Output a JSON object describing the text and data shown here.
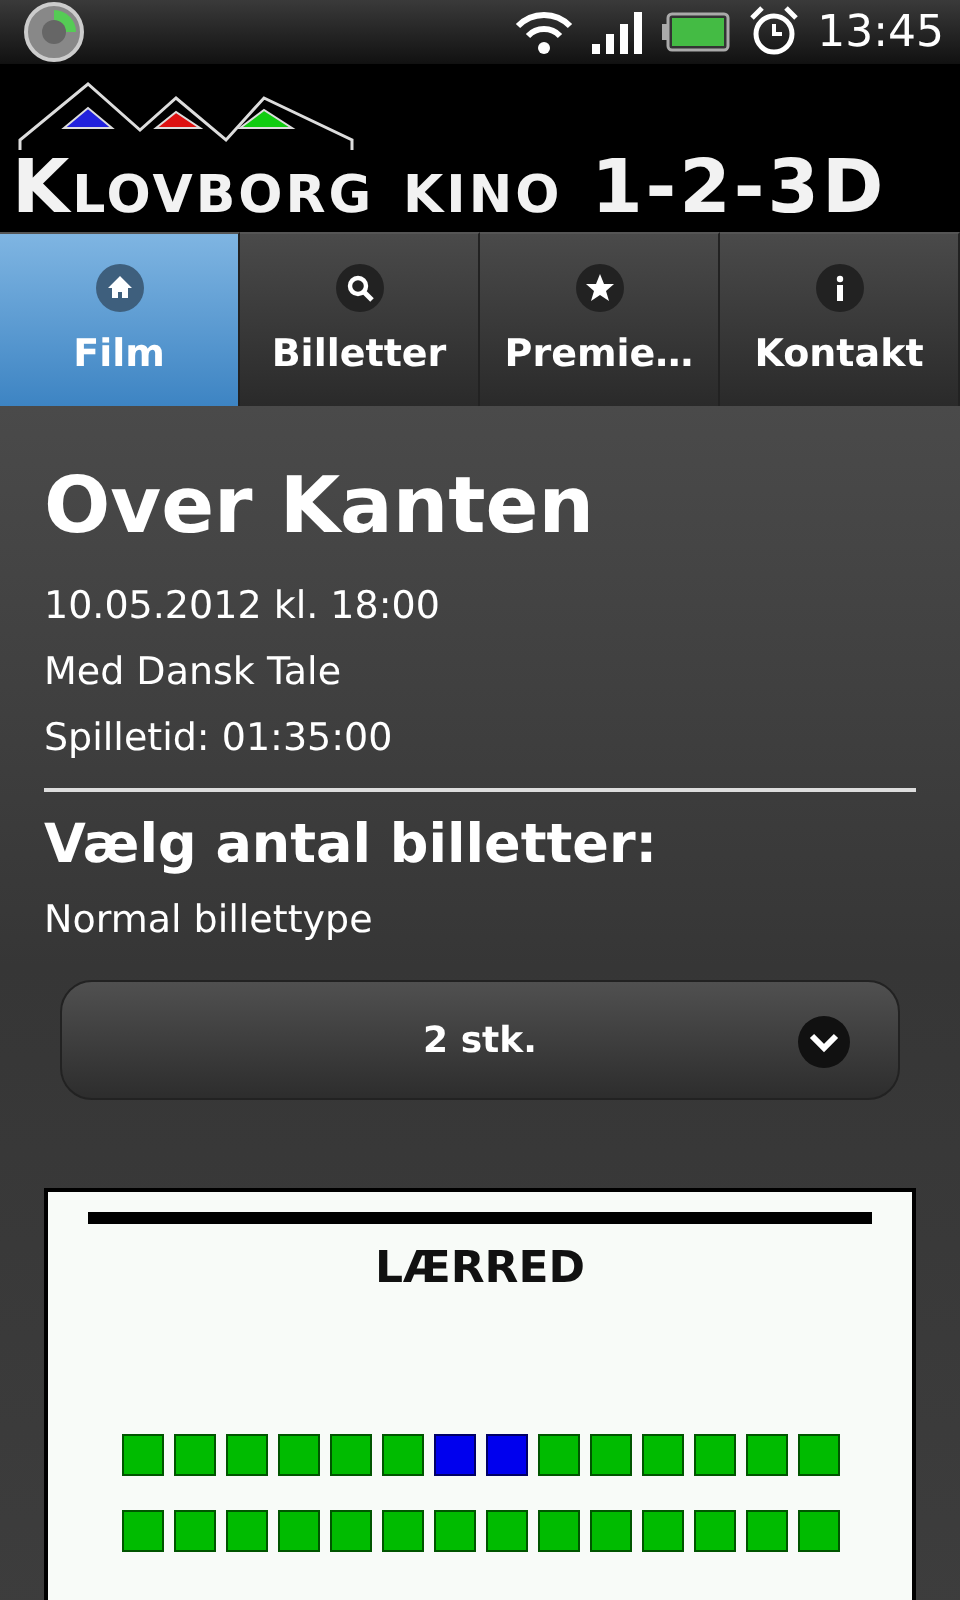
{
  "status_bar": {
    "time": "13:45"
  },
  "header": {
    "logo_text": "Klovborg kino 1-2-3D"
  },
  "tabs": [
    {
      "label": "Film",
      "kind": "home",
      "selected": true
    },
    {
      "label": "Billetter",
      "kind": "search",
      "selected": false
    },
    {
      "label": "Premie…",
      "kind": "star",
      "selected": false
    },
    {
      "label": "Kontakt",
      "kind": "info",
      "selected": false
    }
  ],
  "movie": {
    "title": "Over Kanten",
    "details": [
      "10.05.2012 kl. 18:00",
      "Med Dansk Tale",
      "Spilletid: 01:35:00"
    ]
  },
  "tickets": {
    "heading": "Vælg antal billetter:",
    "type_label": "Normal billettype",
    "quantity": "2 stk."
  },
  "seat_map": {
    "screen_label": "LÆRRED",
    "rows": [
      {
        "seats": [
          {
            "selected": false
          },
          {
            "selected": false
          },
          {
            "selected": false
          },
          {
            "selected": false
          },
          {
            "selected": false
          },
          {
            "selected": false
          },
          {
            "selected": true
          },
          {
            "selected": true
          },
          {
            "selected": false
          },
          {
            "selected": false
          },
          {
            "selected": false
          },
          {
            "selected": false
          },
          {
            "selected": false
          },
          {
            "selected": false
          }
        ]
      },
      {
        "seats": [
          {
            "selected": false
          },
          {
            "selected": false
          },
          {
            "selected": false
          },
          {
            "selected": false
          },
          {
            "selected": false
          },
          {
            "selected": false
          },
          {
            "selected": false
          },
          {
            "selected": false
          },
          {
            "selected": false
          },
          {
            "selected": false
          },
          {
            "selected": false
          },
          {
            "selected": false
          },
          {
            "selected": false
          },
          {
            "selected": false
          }
        ]
      }
    ]
  }
}
